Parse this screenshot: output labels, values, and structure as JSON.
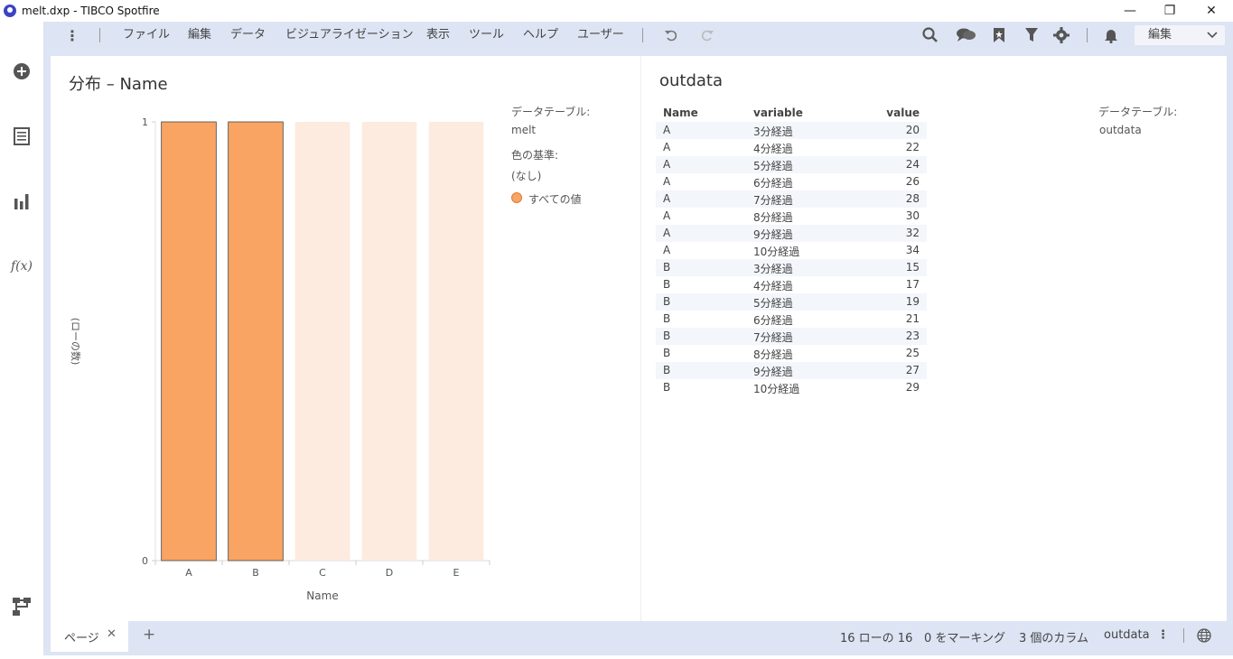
{
  "window": {
    "title": "melt.dxp - TIBCO Spotfire",
    "min": "—",
    "restore": "❐",
    "close": "✕"
  },
  "menu": {
    "items": [
      "ファイル",
      "編集",
      "データ",
      "ビジュアライゼーション",
      "表示",
      "ツール",
      "ヘルプ",
      "ユーザー"
    ],
    "edit_mode": "編集"
  },
  "bar_chart": {
    "title": "分布 – Name",
    "legend": {
      "table_label": "データテーブル:",
      "table_value": "melt",
      "color_label": "色の基準:",
      "color_value": "(なし)",
      "item": "すべての値"
    }
  },
  "chart_data": {
    "type": "bar",
    "categories": [
      "A",
      "B",
      "C",
      "D",
      "E"
    ],
    "values": [
      1,
      1,
      1,
      1,
      1
    ],
    "marked": [
      true,
      true,
      false,
      false,
      false
    ],
    "xlabel": "Name",
    "ylabel": "(ローの数)",
    "ylim": [
      0,
      1
    ],
    "yticks": [
      "0",
      "1"
    ],
    "colors": {
      "marked": "#f9a463",
      "unmarked": "#fdebdf",
      "marked_stroke": "#444444"
    },
    "grid": false
  },
  "table": {
    "title": "outdata",
    "columns": [
      "Name",
      "variable",
      "value"
    ],
    "rows": [
      [
        "A",
        "3分経過",
        "20"
      ],
      [
        "A",
        "4分経過",
        "22"
      ],
      [
        "A",
        "5分経過",
        "24"
      ],
      [
        "A",
        "6分経過",
        "26"
      ],
      [
        "A",
        "7分経過",
        "28"
      ],
      [
        "A",
        "8分経過",
        "30"
      ],
      [
        "A",
        "9分経過",
        "32"
      ],
      [
        "A",
        "10分経過",
        "34"
      ],
      [
        "B",
        "3分経過",
        "15"
      ],
      [
        "B",
        "4分経過",
        "17"
      ],
      [
        "B",
        "5分経過",
        "19"
      ],
      [
        "B",
        "6分経過",
        "21"
      ],
      [
        "B",
        "7分経過",
        "23"
      ],
      [
        "B",
        "8分経過",
        "25"
      ],
      [
        "B",
        "9分経過",
        "27"
      ],
      [
        "B",
        "10分経過",
        "29"
      ]
    ],
    "legend": {
      "table_label": "データテーブル:",
      "table_value": "outdata"
    }
  },
  "status": {
    "page_tab": "ページ",
    "rows": "16 ローの 16",
    "marked": "0 をマーキング",
    "columns": "3 個のカラム",
    "table": "outdata"
  },
  "icons": {
    "add": "add-icon",
    "data": "data-table-icon",
    "viz": "bar-chart-icon",
    "fx": "f(x)",
    "flow": "data-canvas-icon"
  }
}
